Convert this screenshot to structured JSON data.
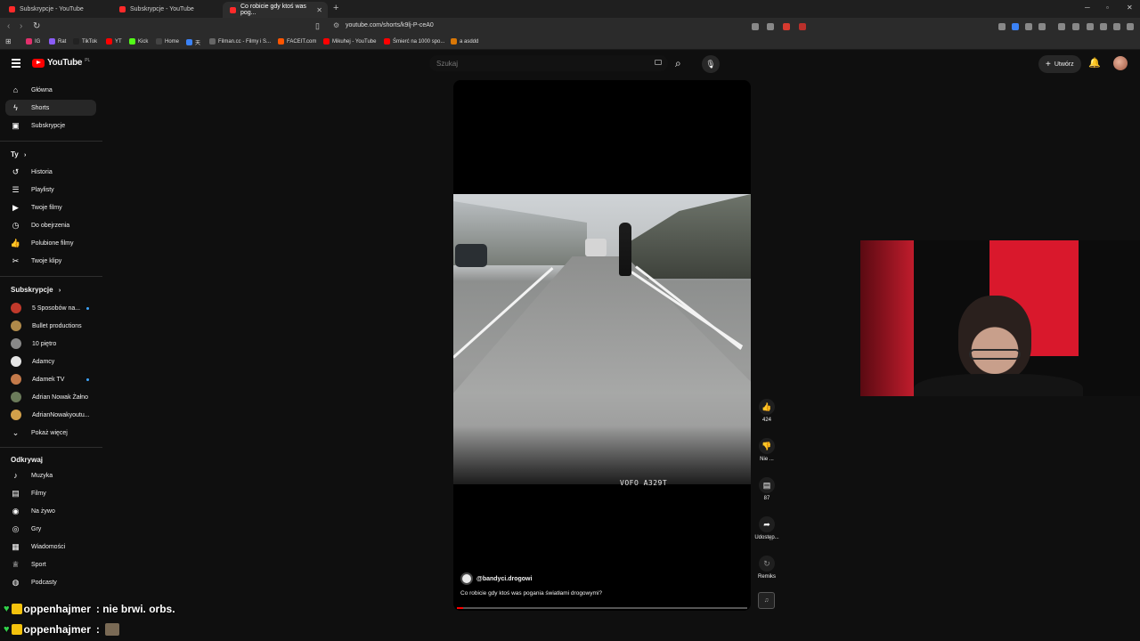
{
  "browser": {
    "tabs": [
      {
        "title": "Subskrypcje - YouTube"
      },
      {
        "title": "Subskrypcje - YouTube"
      },
      {
        "title": "Co robicie gdy ktoś was pog..."
      }
    ],
    "new_tab": "+",
    "url": "youtube.com/shorts/k9lj-P-ceA0",
    "bookmarks": [
      {
        "label": "IG",
        "color": "#e1306c"
      },
      {
        "label": "Rat",
        "color": "#8a5cf6"
      },
      {
        "label": "TikTok",
        "color": "#222222"
      },
      {
        "label": "YT",
        "color": "#ff0000"
      },
      {
        "label": "Kick",
        "color": "#53fc18"
      },
      {
        "label": "Home",
        "color": "#444444"
      },
      {
        "label": "天",
        "color": "#3b82f6"
      },
      {
        "label": "Filman.cc - Filmy i S...",
        "color": "#666666"
      },
      {
        "label": "FACEIT.com",
        "color": "#ff5500"
      },
      {
        "label": "Mikuhej - YouTube",
        "color": "#ff0000"
      },
      {
        "label": "Śmierć na 1000 spo...",
        "color": "#ff0000"
      },
      {
        "label": "a asddd",
        "color": "#d97706"
      }
    ]
  },
  "header": {
    "logo_text": "YouTube",
    "logo_region": "PL",
    "search_placeholder": "Szukaj",
    "create_label": "Utwórz"
  },
  "sidebar": {
    "main": [
      {
        "label": "Główna",
        "icon": "home-icon"
      },
      {
        "label": "Shorts",
        "icon": "shorts-icon"
      },
      {
        "label": "Subskrypcje",
        "icon": "subscriptions-icon"
      }
    ],
    "you_heading": "Ty",
    "you_items": [
      {
        "label": "Historia",
        "icon": "history-icon"
      },
      {
        "label": "Playlisty",
        "icon": "playlist-icon"
      },
      {
        "label": "Twoje filmy",
        "icon": "your-videos-icon"
      },
      {
        "label": "Do obejrzenia",
        "icon": "watch-later-icon"
      },
      {
        "label": "Polubione filmy",
        "icon": "like-icon"
      },
      {
        "label": "Twoje klipy",
        "icon": "clips-icon"
      }
    ],
    "subs_heading": "Subskrypcje",
    "subs": [
      {
        "label": "5 Sposobów na...",
        "color": "#c0392b",
        "dot": true
      },
      {
        "label": "Bullet productions",
        "color": "#b08a4a",
        "dot": false
      },
      {
        "label": "10 piętro",
        "color": "#888888",
        "dot": false
      },
      {
        "label": "Adamcy",
        "color": "#e5e5e5",
        "dot": false
      },
      {
        "label": "Adamek TV",
        "color": "#c47a4a",
        "dot": true
      },
      {
        "label": "Adrian Nowak Żałno",
        "color": "#6b7b5a",
        "dot": false
      },
      {
        "label": "AdrianNowakyoutu...",
        "color": "#d2a04a",
        "dot": false
      }
    ],
    "show_more": "Pokaż więcej",
    "explore_heading": "Odkrywaj",
    "explore": [
      {
        "label": "Muzyka",
        "icon": "music-icon"
      },
      {
        "label": "Filmy",
        "icon": "film-icon"
      },
      {
        "label": "Na żywo",
        "icon": "live-icon"
      },
      {
        "label": "Gry",
        "icon": "gaming-icon"
      },
      {
        "label": "Wiadomości",
        "icon": "news-icon"
      },
      {
        "label": "Sport",
        "icon": "trophy-icon"
      },
      {
        "label": "Podcasty",
        "icon": "podcast-icon"
      }
    ]
  },
  "short": {
    "plate_text": "VOFO A329T",
    "channel": "@bandyci.drogowi",
    "title": "Co robicie gdy ktoś was pogania światłami drogowymi?",
    "progress_fraction": 0.02
  },
  "actions": {
    "likes": "424",
    "dislike_label": "Nie ...",
    "comments": "87",
    "share_label": "Udostęp...",
    "remix_label": "Remiks"
  },
  "chat": [
    {
      "user": "oppenhajmer",
      "message": ": nie brwi. orbs."
    },
    {
      "user": "oppenhajmer",
      "message": ":"
    }
  ],
  "colors": {
    "accent": "#ff0000",
    "background": "#0f0f0f",
    "chat_heart": "#32d24b"
  }
}
